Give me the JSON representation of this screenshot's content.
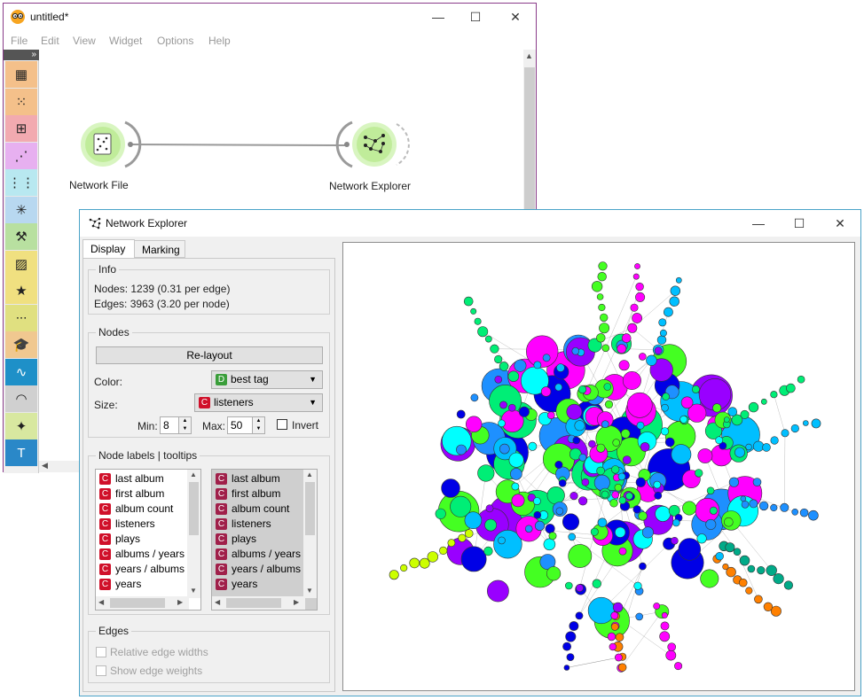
{
  "canvas_window": {
    "title": "untitled*",
    "controls": {
      "minimize": "—",
      "maximize": "☐",
      "close": "✕"
    },
    "menu": [
      "File",
      "Edit",
      "View",
      "Widget",
      "Options",
      "Help"
    ],
    "toolbox_toggle": "»",
    "toolbox_categories": [
      {
        "name": "data-table",
        "color": "#f4c08a"
      },
      {
        "name": "scatter-plot",
        "color": "#f4c08a"
      },
      {
        "name": "tree-viewer",
        "color": "#f2aab0"
      },
      {
        "name": "projection",
        "color": "#e7b0f0"
      },
      {
        "name": "feature-grid",
        "color": "#b8e8f0"
      },
      {
        "name": "network",
        "color": "#b8d8f0"
      },
      {
        "name": "worker",
        "color": "#b8e0a0"
      },
      {
        "name": "image",
        "color": "#f0e080"
      },
      {
        "name": "star",
        "color": "#f0e080"
      },
      {
        "name": "chain",
        "color": "#e0e080"
      },
      {
        "name": "education",
        "color": "#f0c890"
      },
      {
        "name": "timeseries",
        "color": "#1e90c8"
      },
      {
        "name": "spectroscopy",
        "color": "#d0d0d0"
      },
      {
        "name": "sparkle",
        "color": "#d8e8a0"
      },
      {
        "name": "text",
        "color": "#2a88c8"
      }
    ],
    "widgets": [
      {
        "label": "Network File"
      },
      {
        "label": "Network Explorer"
      }
    ]
  },
  "explorer_window": {
    "title": "Network Explorer",
    "controls": {
      "minimize": "—",
      "maximize": "☐",
      "close": "✕"
    },
    "tabs": [
      "Display",
      "Marking"
    ],
    "info": {
      "title": "Info",
      "nodes": "Nodes: 1239 (0.31 per edge)",
      "edges": "Edges: 3963 (3.20 per node)"
    },
    "nodes_group": {
      "title": "Nodes",
      "relayout": "Re-layout",
      "color_label": "Color:",
      "color_value": "best tag",
      "color_badge": "D",
      "size_label": "Size:",
      "size_value": "listeners",
      "size_badge": "C",
      "min_label": "Min:",
      "min_value": "8",
      "max_label": "Max:",
      "max_value": "50",
      "invert_label": "Invert"
    },
    "labels_group": {
      "title": "Node labels | tooltips",
      "badge": "C",
      "left_items": [
        "last album",
        "first album",
        "album count",
        "listeners",
        "plays",
        "albums / years",
        "years / albums",
        "years"
      ],
      "right_items": [
        "last album",
        "first album",
        "album count",
        "listeners",
        "plays",
        "albums / years",
        "years / albums",
        "years"
      ]
    },
    "edges_group": {
      "title": "Edges",
      "relative_widths": "Relative edge widths",
      "show_weights": "Show edge weights"
    },
    "palette": [
      "#0000e6",
      "#1e90ff",
      "#00bfff",
      "#00ffff",
      "#00ee76",
      "#44ff22",
      "#ff00ff",
      "#9900ff",
      "#ff0000",
      "#ff8000",
      "#ccff00",
      "#00aa88"
    ]
  }
}
